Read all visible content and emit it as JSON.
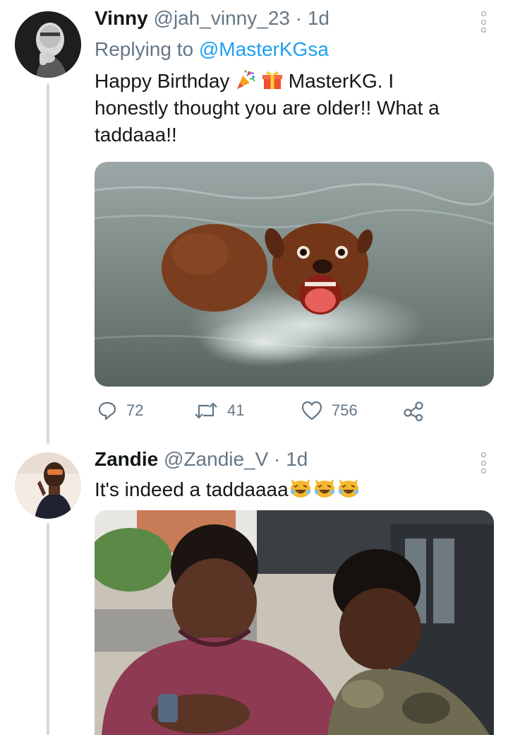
{
  "tweets": [
    {
      "name": "Vinny",
      "handle": "@jah_vinny_23",
      "separator": "·",
      "time": "1d",
      "replying_prefix": "Replying to",
      "replying_to": "@MasterKGsa",
      "text_part1": "Happy Birthday",
      "text_part2": "MasterKG. I",
      "text_line2": "honestly thought you are older!! What a",
      "text_line3": "taddaaa!!",
      "emojis": [
        "party-popper-icon",
        "gift-icon"
      ],
      "stats": {
        "replies": "72",
        "retweets": "41",
        "likes": "756"
      }
    },
    {
      "name": "Zandie",
      "handle": "@Zandie_V",
      "separator": "·",
      "time": "1d",
      "text": "It's indeed a taddaaaa",
      "emojis": [
        "laughing-cat-icon",
        "laughing-cat-icon",
        "laughing-cat-icon"
      ]
    }
  ],
  "colors": {
    "accent": "#1da1f2",
    "secondary_text": "#657786",
    "thread_line": "#cfd9de"
  }
}
